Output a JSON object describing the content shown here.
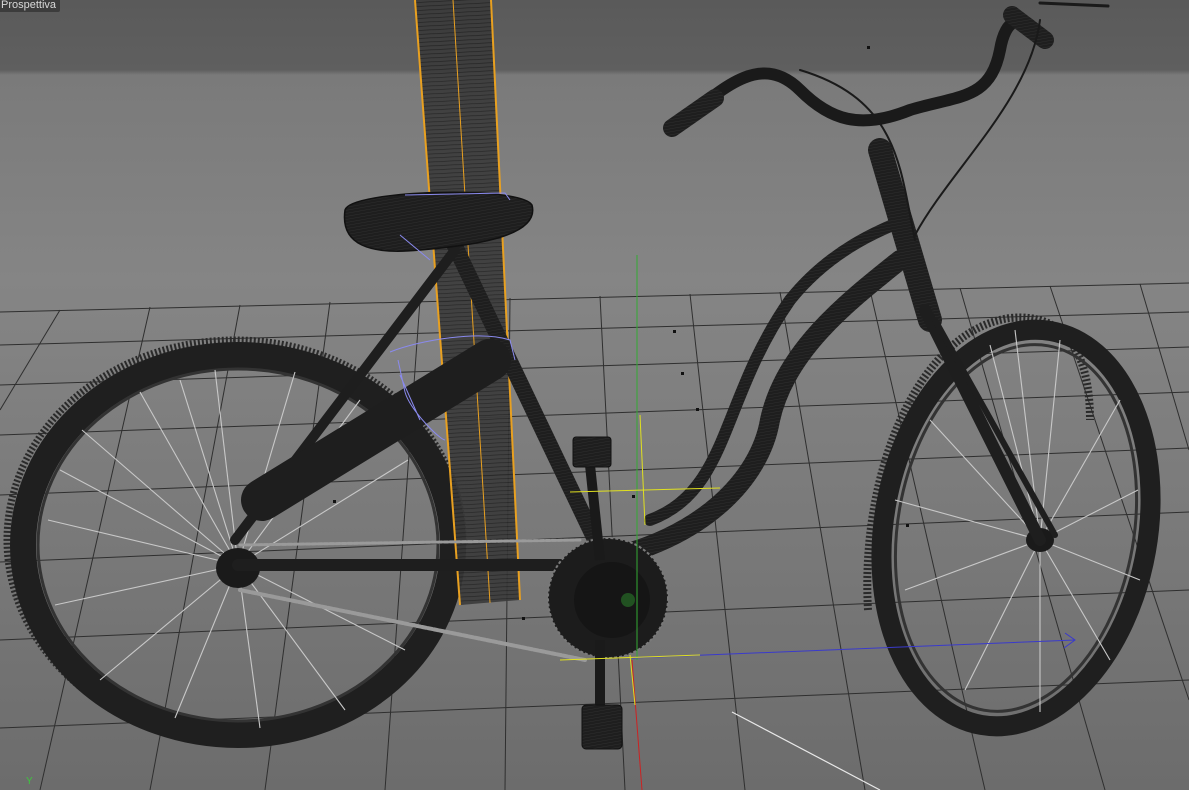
{
  "viewport": {
    "label": "Prospettiva",
    "axis_indicator": "Y"
  },
  "colors": {
    "background_top": "#5a5a5a",
    "background_mid": "#858585",
    "grid_line": "#2e2e2e",
    "wireframe": "#1a1a1a",
    "selection_highlight": "#e8a020",
    "spokes": "#c8c8c8",
    "axis_x": "#3a3acc",
    "axis_y": "#33aa33",
    "axis_z": "#cc2222",
    "manipulator": "#e0e020",
    "helper_outline": "#8a8aee"
  }
}
